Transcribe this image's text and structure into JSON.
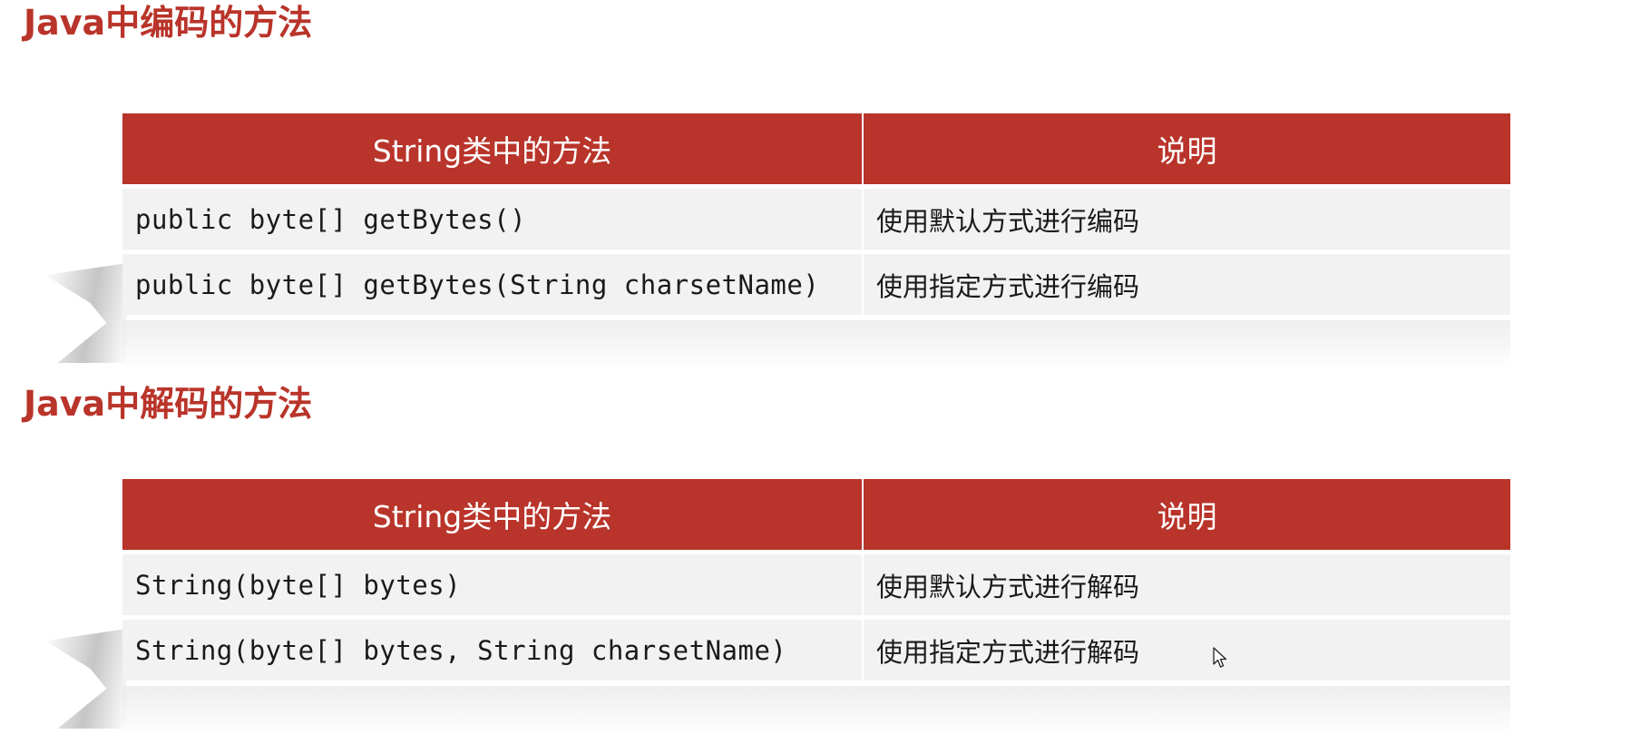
{
  "encode_section": {
    "title": "Java中编码的方法",
    "headers": {
      "method": "String类中的方法",
      "desc": "说明"
    },
    "rows": [
      {
        "method": "public byte[] getBytes()",
        "desc": "使用默认方式进行编码"
      },
      {
        "method": "public byte[] getBytes(String charsetName)",
        "desc": "使用指定方式进行编码"
      }
    ]
  },
  "decode_section": {
    "title": "Java中解码的方法",
    "headers": {
      "method": "String类中的方法",
      "desc": "说明"
    },
    "rows": [
      {
        "method": "String(byte[] bytes)",
        "desc": "使用默认方式进行解码"
      },
      {
        "method": "String(byte[] bytes, String charsetName)",
        "desc": "使用指定方式进行解码"
      }
    ]
  },
  "colors": {
    "accent": "#b9342a",
    "row_bg": "#f2f2f2",
    "text": "#1a1a1a"
  },
  "icons": {
    "cursor": "mouse-pointer-icon"
  }
}
